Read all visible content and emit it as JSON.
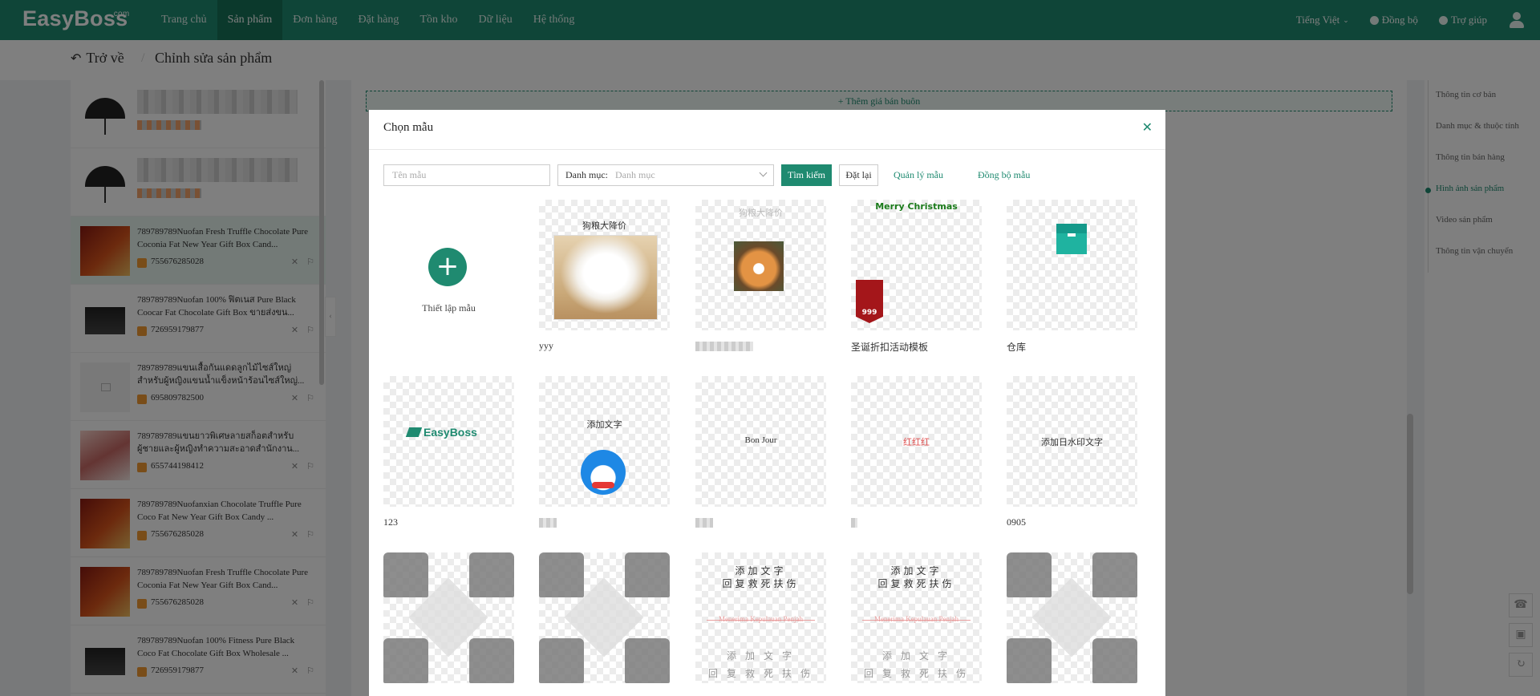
{
  "app": {
    "logo": "EasyBoss",
    "logo_suffix": ".com",
    "nav": [
      "Trang chủ",
      "Sản phẩm",
      "Đơn hàng",
      "Đặt hàng",
      "Tồn kho",
      "Dữ liệu",
      "Hệ thống"
    ],
    "nav_active": "Sản phẩm",
    "language": "Tiếng Việt",
    "sync": "Đồng bộ",
    "help": "Trợ giúp"
  },
  "page": {
    "back": "Trở về",
    "title": "Chỉnh sửa sản phẩm",
    "wholesale_button": "Thêm giá bán buôn"
  },
  "products": [
    {
      "thumb": "umbrella",
      "title": "",
      "sku": "",
      "blurred": true
    },
    {
      "thumb": "umbrella",
      "title": "",
      "sku": "",
      "blurred": true
    },
    {
      "thumb": "box",
      "title": "789789789Nuofan Fresh Truffle Chocolate Pure Coconia Fat New Year Gift Box Cand...",
      "sku": "755676285028",
      "selected": true
    },
    {
      "thumb": "black",
      "title": "789789789Nuofan 100% ฟิตเนส Pure Black Coocar Fat Chocolate Gift Box ขายส่งขน...",
      "sku": "726959179877"
    },
    {
      "thumb": "gray",
      "title": "789789789แขนเสื้อกันแดดลูกไม้ไซส์ใหญ่ สำหรับผู้หญิงแขนน้ำแข็งหน้าร้อนไซส์ใหญ่...",
      "sku": "695809782500"
    },
    {
      "thumb": "pink",
      "title": "789789789แขนยาวพิเศษลายสก็อตสำหรับ ผู้ชายและผู้หญิงทำความสะอาดสำนักงาน...",
      "sku": "655744198412"
    },
    {
      "thumb": "box",
      "title": "789789789Nuofanxian Chocolate Truffle Pure Coco Fat New Year Gift Box Candy ...",
      "sku": "755676285028"
    },
    {
      "thumb": "box",
      "title": "789789789Nuofan Fresh Truffle Chocolate Pure Coconia Fat New Year Gift Box Cand...",
      "sku": "755676285028"
    },
    {
      "thumb": "black",
      "title": "789789789Nuofan 100% Fitness Pure Black Coco Fat Chocolate Gift Box Wholesale ...",
      "sku": "726959179877"
    }
  ],
  "anchors": [
    "Thông tin cơ bản",
    "Danh mục & thuộc tính",
    "Thông tin bán hàng",
    "Hình ảnh sản phẩm",
    "Video sản phẩm",
    "Thông tin vận chuyển"
  ],
  "anchor_active": "Hình ảnh sản phẩm",
  "modal": {
    "title": "Chọn mẫu",
    "name_placeholder": "Tên mẫu",
    "category_label": "Danh mục:",
    "category_placeholder": "Danh mục",
    "search_button": "Tìm kiếm",
    "reset_button": "Đặt lại",
    "manage_link": "Quản lý mẫu",
    "sync_link": "Đồng bộ mẫu",
    "create_label": "Thiết lập mẫu",
    "templates": [
      {
        "name": "yyy",
        "art": "puppy",
        "overlay_text": "狗粮大降价"
      },
      {
        "name": "",
        "art": "shiba",
        "overlay_text": "狗粮大降价",
        "name_blurred": true
      },
      {
        "name": "圣诞折扣活动模板",
        "art": "xmas",
        "overlay_text": "Merry Christmas",
        "badge": "999"
      },
      {
        "name": "仓库",
        "art": "cube"
      },
      {
        "name": "123",
        "art": "easyboss",
        "overlay_text": "EasyBoss"
      },
      {
        "name": "",
        "art": "doraemon",
        "overlay_text": "添加文字",
        "name_blurred": true
      },
      {
        "name": "",
        "art": "text",
        "overlay_text": "Bon Jour",
        "name_blurred": true
      },
      {
        "name": "",
        "art": "text-red",
        "overlay_text": "红红红",
        "name_blurred": true
      },
      {
        "name": "0905",
        "art": "text",
        "overlay_text": "添加日水印文字"
      },
      {
        "name": "",
        "art": "shirts"
      },
      {
        "name": "",
        "art": "shirts"
      },
      {
        "name": "",
        "art": "cn",
        "line1": "添加文字",
        "line2": "回复救死扶伤",
        "line3": "Menerima Kepulauan Penjah",
        "line4": "添 加 文 字",
        "line5": "回 复 救 死 扶 伤"
      },
      {
        "name": "",
        "art": "cn",
        "line1": "添加文字",
        "line2": "回复救死扶伤",
        "line3": "Menerima Kepulauan Penjah",
        "line4": "添 加 文 字",
        "line5": "回 复 救 死 扶 伤"
      },
      {
        "name": "",
        "art": "shirts"
      }
    ]
  },
  "colors": {
    "brand": "#1f8a70",
    "brand_dark": "#177259"
  }
}
